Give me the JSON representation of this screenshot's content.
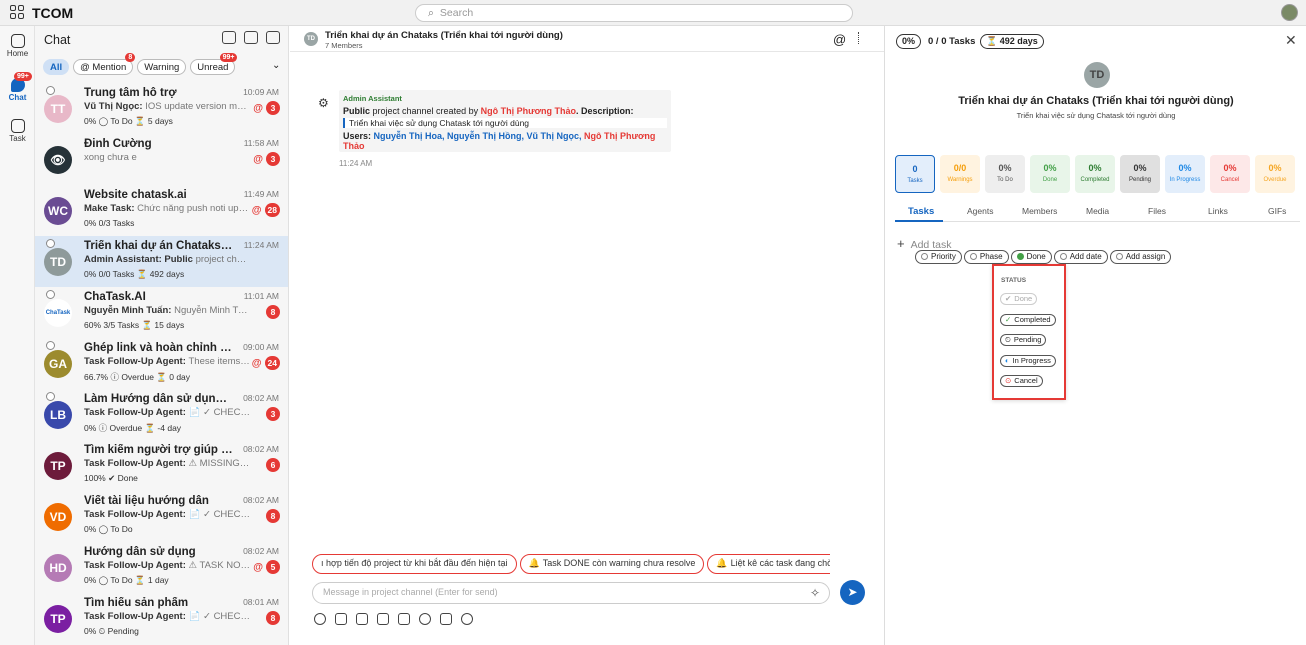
{
  "app": {
    "name": "TCOM"
  },
  "search": {
    "placeholder": "Search"
  },
  "rail": {
    "home": "Home",
    "chat": "Chat",
    "chat_badge": "99+",
    "task": "Task"
  },
  "chatlist": {
    "title": "Chat",
    "filters": [
      {
        "label": "All"
      },
      {
        "label": "@ Mention",
        "badge": "8"
      },
      {
        "label": "Warning"
      },
      {
        "label": "Unread",
        "badge": "99+"
      }
    ],
    "items": [
      {
        "avatar": "TT",
        "color": "#e8b8c8",
        "name": "Trung tâm hỗ trợ",
        "time": "10:09 AM",
        "sender": "Vũ Thị Ngọc:",
        "msg": "IOS update version mới tr...",
        "meta": "0% ◯ To Do ⏳ 5 days",
        "mention": true,
        "count": "3",
        "flag": true
      },
      {
        "avatar": "👁",
        "color": "#263238",
        "name": "Đinh Cường",
        "time": "11:58 AM",
        "sender": "",
        "msg": "xong chưa e",
        "meta": "",
        "mention": true,
        "count": "3"
      },
      {
        "avatar": "WC",
        "color": "#6a4c93",
        "name": "Website chatask.ai",
        "time": "11:49 AM",
        "sender": "Make Task:",
        "msg": "Chức năng push noti updat...",
        "meta": "0% 0/3 Tasks",
        "mention": true,
        "count": "28"
      },
      {
        "avatar": "TD",
        "color": "#8e9a9a",
        "name": "Triển khai dự án Chataks (...",
        "time": "11:24 AM",
        "sender": "Admin Assistant: Public",
        "msg": "project channel creat...",
        "meta": "0% 0/0 Tasks ⏳ 492 days",
        "flag": true
      },
      {
        "avatar": "ChaTask",
        "color": "#ffffff",
        "name": "ChaTask.AI",
        "time": "11:01 AM",
        "sender": "Nguyễn Minh Tuấn:",
        "msg": "Nguyễn Minh Tuấn up...",
        "meta": "60% 3/5 Tasks ⏳ 15 days",
        "count": "8",
        "flag": true
      },
      {
        "avatar": "GA",
        "color": "#9c8b2e",
        "name": "Ghép link và hoàn chỉnh p...",
        "time": "09:00 AM",
        "sender": "Task Follow-Up Agent:",
        "msg": "These items ar...",
        "meta": "66.7% ⓘ Overdue ⏳ 0 day",
        "mention": true,
        "count": "24",
        "flag": true
      },
      {
        "avatar": "LB",
        "color": "#3949ab",
        "name": "Làm Hướng dẫn sử dụng ...",
        "time": "08:02 AM",
        "sender": "Task Follow-Up Agent:",
        "msg": "📄 ✓ CHECK PR...",
        "meta": "0% ⓘ Overdue ⏳ -4 day",
        "count": "3",
        "flag": true
      },
      {
        "avatar": "TP",
        "color": "#6d1b3b",
        "name": "Tìm kiếm người trợ giúp đ...",
        "time": "08:02 AM",
        "sender": "Task Follow-Up Agent:",
        "msg": "⚠ MISSING DAT...",
        "meta": "100% ✔ Done",
        "count": "6"
      },
      {
        "avatar": "VD",
        "color": "#ef6c00",
        "name": "Viết tài liệu hướng dẫn",
        "time": "08:02 AM",
        "sender": "Task Follow-Up Agent:",
        "msg": "📄 ✓ CHECK PR...",
        "meta": "0% ◯ To Do",
        "count": "8"
      },
      {
        "avatar": "HD",
        "color": "#b57bb5",
        "name": "Hướng dẫn sử dụng",
        "time": "08:02 AM",
        "sender": "Task Follow-Up Agent:",
        "msg": "⚠ TASK NOT ...",
        "meta": "0% ◯ To Do ⏳ 1 day",
        "mention": true,
        "count": "5"
      },
      {
        "avatar": "TP",
        "color": "#7b1fa2",
        "name": "Tìm hiểu sản phẩm",
        "time": "08:01 AM",
        "sender": "Task Follow-Up Agent:",
        "msg": "📄 ✓ CHECK PR...",
        "meta": "0% ⏲ Pending",
        "count": "8"
      }
    ]
  },
  "channel": {
    "avatar": "TD",
    "title": "Triển khai dự án Chataks (Triển khai tới người dùng)",
    "members": "7 Members",
    "message": {
      "from": "Admin Assistant",
      "line1_a": "Public",
      "line1_b": " project channel created by ",
      "line1_c": "Ngô Thị Phương Thảo",
      "line1_d": ". Description:",
      "quote": "Triển khai việc sử dụng Chatask tới người dùng",
      "users_label": "Users: ",
      "users_blue": "Nguyễn Thị Hoa, Nguyễn Thị Hồng, Vũ Thị Ngọc, ",
      "users_red": "Ngô Thị Phương Thảo",
      "time": "11:24 AM"
    },
    "suggestions": [
      "ı hợp tiến độ project từ khi bắt đầu đến hiện tại",
      "Task DONE còn warning chưa resolve",
      "Liệt kê các task đang chờ phê"
    ],
    "composer_placeholder": "Message in project channel (Enter for send)"
  },
  "panel": {
    "progress": "0%",
    "tasks": "0 / 0 Tasks",
    "days": "⏳ 492 days",
    "avatar": "TD",
    "title": "Triển khai dự án Chataks (Triển khai tới người dùng)",
    "desc": "Triển khai việc sử dụng Chatask tới người dùng",
    "stats": [
      {
        "v": "0",
        "l": "Tasks",
        "bg": "#e3eefb",
        "c": "#1565c0",
        "border": "#1565c0"
      },
      {
        "v": "0/0",
        "l": "Warnings",
        "bg": "#fff3e0",
        "c": "#f59e0b"
      },
      {
        "v": "0%",
        "l": "To Do",
        "bg": "#eeeeee",
        "c": "#555"
      },
      {
        "v": "0%",
        "l": "Done",
        "bg": "#e8f5e9",
        "c": "#43a047"
      },
      {
        "v": "0%",
        "l": "Completed",
        "bg": "#e8f5e9",
        "c": "#2e7d32"
      },
      {
        "v": "0%",
        "l": "Pending",
        "bg": "#e0e0e0",
        "c": "#333"
      },
      {
        "v": "0%",
        "l": "In Progress",
        "bg": "#e3eefb",
        "c": "#1e88e5"
      },
      {
        "v": "0%",
        "l": "Cancel",
        "bg": "#fde8e8",
        "c": "#e53935"
      },
      {
        "v": "0%",
        "l": "Overdue",
        "bg": "#fff3e0",
        "c": "#f5a623"
      }
    ],
    "tabs": [
      "Tasks",
      "Agents",
      "Members",
      "Media",
      "Files",
      "Links",
      "GIFs"
    ],
    "add_task": "Add task",
    "task_opts": [
      "Priority",
      "Phase",
      "Done",
      "Add date",
      "Add assign"
    ],
    "status_header": "STATUS",
    "status_items": [
      "Done",
      "Completed",
      "Pending",
      "In Progress",
      "Cancel"
    ]
  }
}
